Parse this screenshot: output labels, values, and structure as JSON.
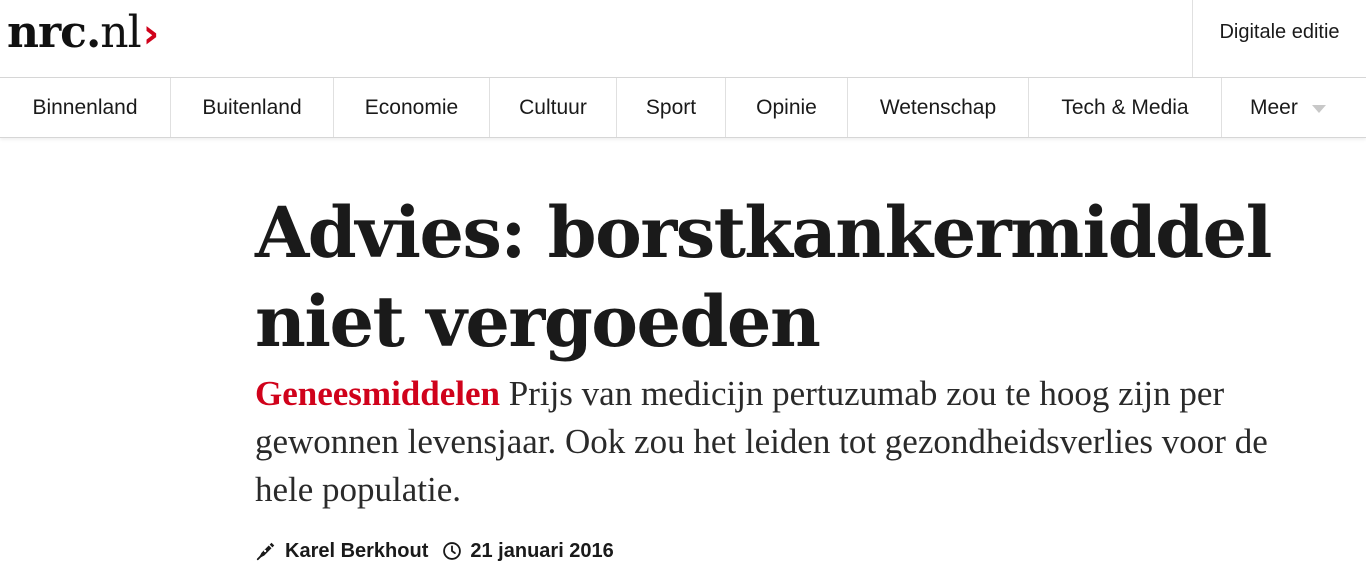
{
  "header": {
    "logo": {
      "text_bold": "nrc",
      "dot": ".",
      "text_light": "nl",
      "chevron": "›",
      "accent_color": "#d0021b"
    },
    "digital_edition_label": "Digitale editie"
  },
  "nav": {
    "items": [
      {
        "label": "Binnenland"
      },
      {
        "label": "Buitenland"
      },
      {
        "label": "Economie"
      },
      {
        "label": "Cultuur"
      },
      {
        "label": "Sport"
      },
      {
        "label": "Opinie"
      },
      {
        "label": "Wetenschap"
      },
      {
        "label": "Tech & Media"
      },
      {
        "label": "Meer",
        "icon": "chevron-down-icon"
      }
    ]
  },
  "article": {
    "headline": "Advies: borstkankermiddel niet vergoeden",
    "kicker": "Geneesmiddelen",
    "lede": " Prijs van medicijn pertuzumab zou te hoog zijn per gewonnen levensjaar. Ook zou het leiden tot gezondheidsverlies voor de hele populatie.",
    "author": "Karel Berkhout",
    "date": "21 januari 2016",
    "author_icon": "pen-icon",
    "date_icon": "clock-icon"
  }
}
